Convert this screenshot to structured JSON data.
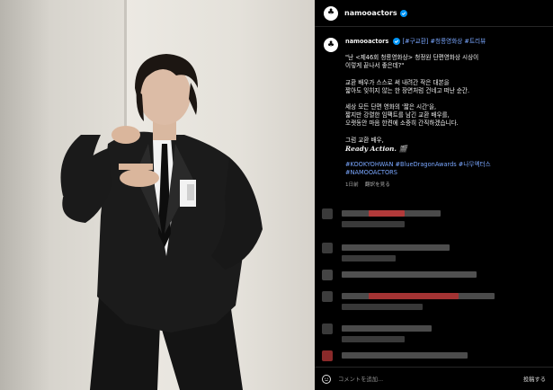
{
  "account": {
    "username": "namooactors",
    "header_username": "namooactors"
  },
  "caption": {
    "username": "namooactors",
    "tags_inline": "[#구교환] #청룡영화상 #트리뷰",
    "line1": "\"난 <제46회 청룡영화상> 청정원 단편영화상 시상이",
    "line2": "이렇게 끝나서 좋은데?\"",
    "line3": "교환 배우가 스스로 써 내려간 작은 대본을",
    "line4": "짧아도 잊히지 않는 한 장면처럼 건네고 떠난 순간.",
    "line5": "세상 모든 단편 영화의 '짧은 시간'을,",
    "line6": "짧지만 강렬한 임팩트를 남긴 교환 배우를,",
    "line7": "오랫동안 마음 한켠에 소중히 간직하겠습니다.",
    "line8": "그럼 교환 배우,",
    "ready": "Ready Action.",
    "hashtags1": "#KOOKYOHWAN #BlueDragonAwards #나무엑터스",
    "hashtags2": "#NAMOOACTORS"
  },
  "meta": {
    "time": "1日前",
    "translate": "翻訳を見る"
  },
  "footer": {
    "placeholder": "コメントを追加...",
    "post_label": "投稿する"
  },
  "colors": {
    "link": "#7aa7ff",
    "verified": "#0095f6",
    "background": "#000000"
  },
  "icons": [
    "tree-logo-icon",
    "verified-badge-icon",
    "emoji-icon"
  ]
}
